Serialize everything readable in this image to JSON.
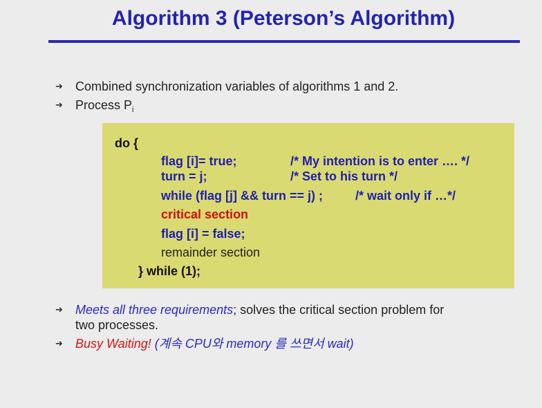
{
  "slide": {
    "title": "Algorithm 3 (Peterson’s Algorithm)",
    "bullets_top": [
      {
        "text": "Combined synchronization variables of algorithms 1 and 2."
      },
      {
        "text": "Process P",
        "sub": "i"
      }
    ],
    "code": {
      "do_open": "do {",
      "flag_true": "flag [i]= true;",
      "flag_true_comment": "/* My intention is to enter …. */",
      "turn": "turn = j;",
      "turn_comment": "/* Set to his turn */",
      "while_line": "while (flag [j] && turn == j) ;",
      "while_comment": "/* wait only if …*/",
      "critical": "critical section",
      "flag_false": "flag [i] = false;",
      "remainder": "remainder section",
      "close": "} while (1);"
    },
    "bullets_bottom": [
      {
        "highlight": "Meets all three requirements",
        "rest_line1": "; solves the critical section problem for",
        "rest_line2": "two processes."
      },
      {
        "highlight": "Busy Waiting!",
        "rest": " (계속 CPU와  memory 를 쓰면서 wait)"
      }
    ],
    "colors": {
      "title": "#2323b4",
      "code_background": "#dada72",
      "code_blue": "#1f1fb0",
      "critical_red": "#cc1111"
    }
  }
}
